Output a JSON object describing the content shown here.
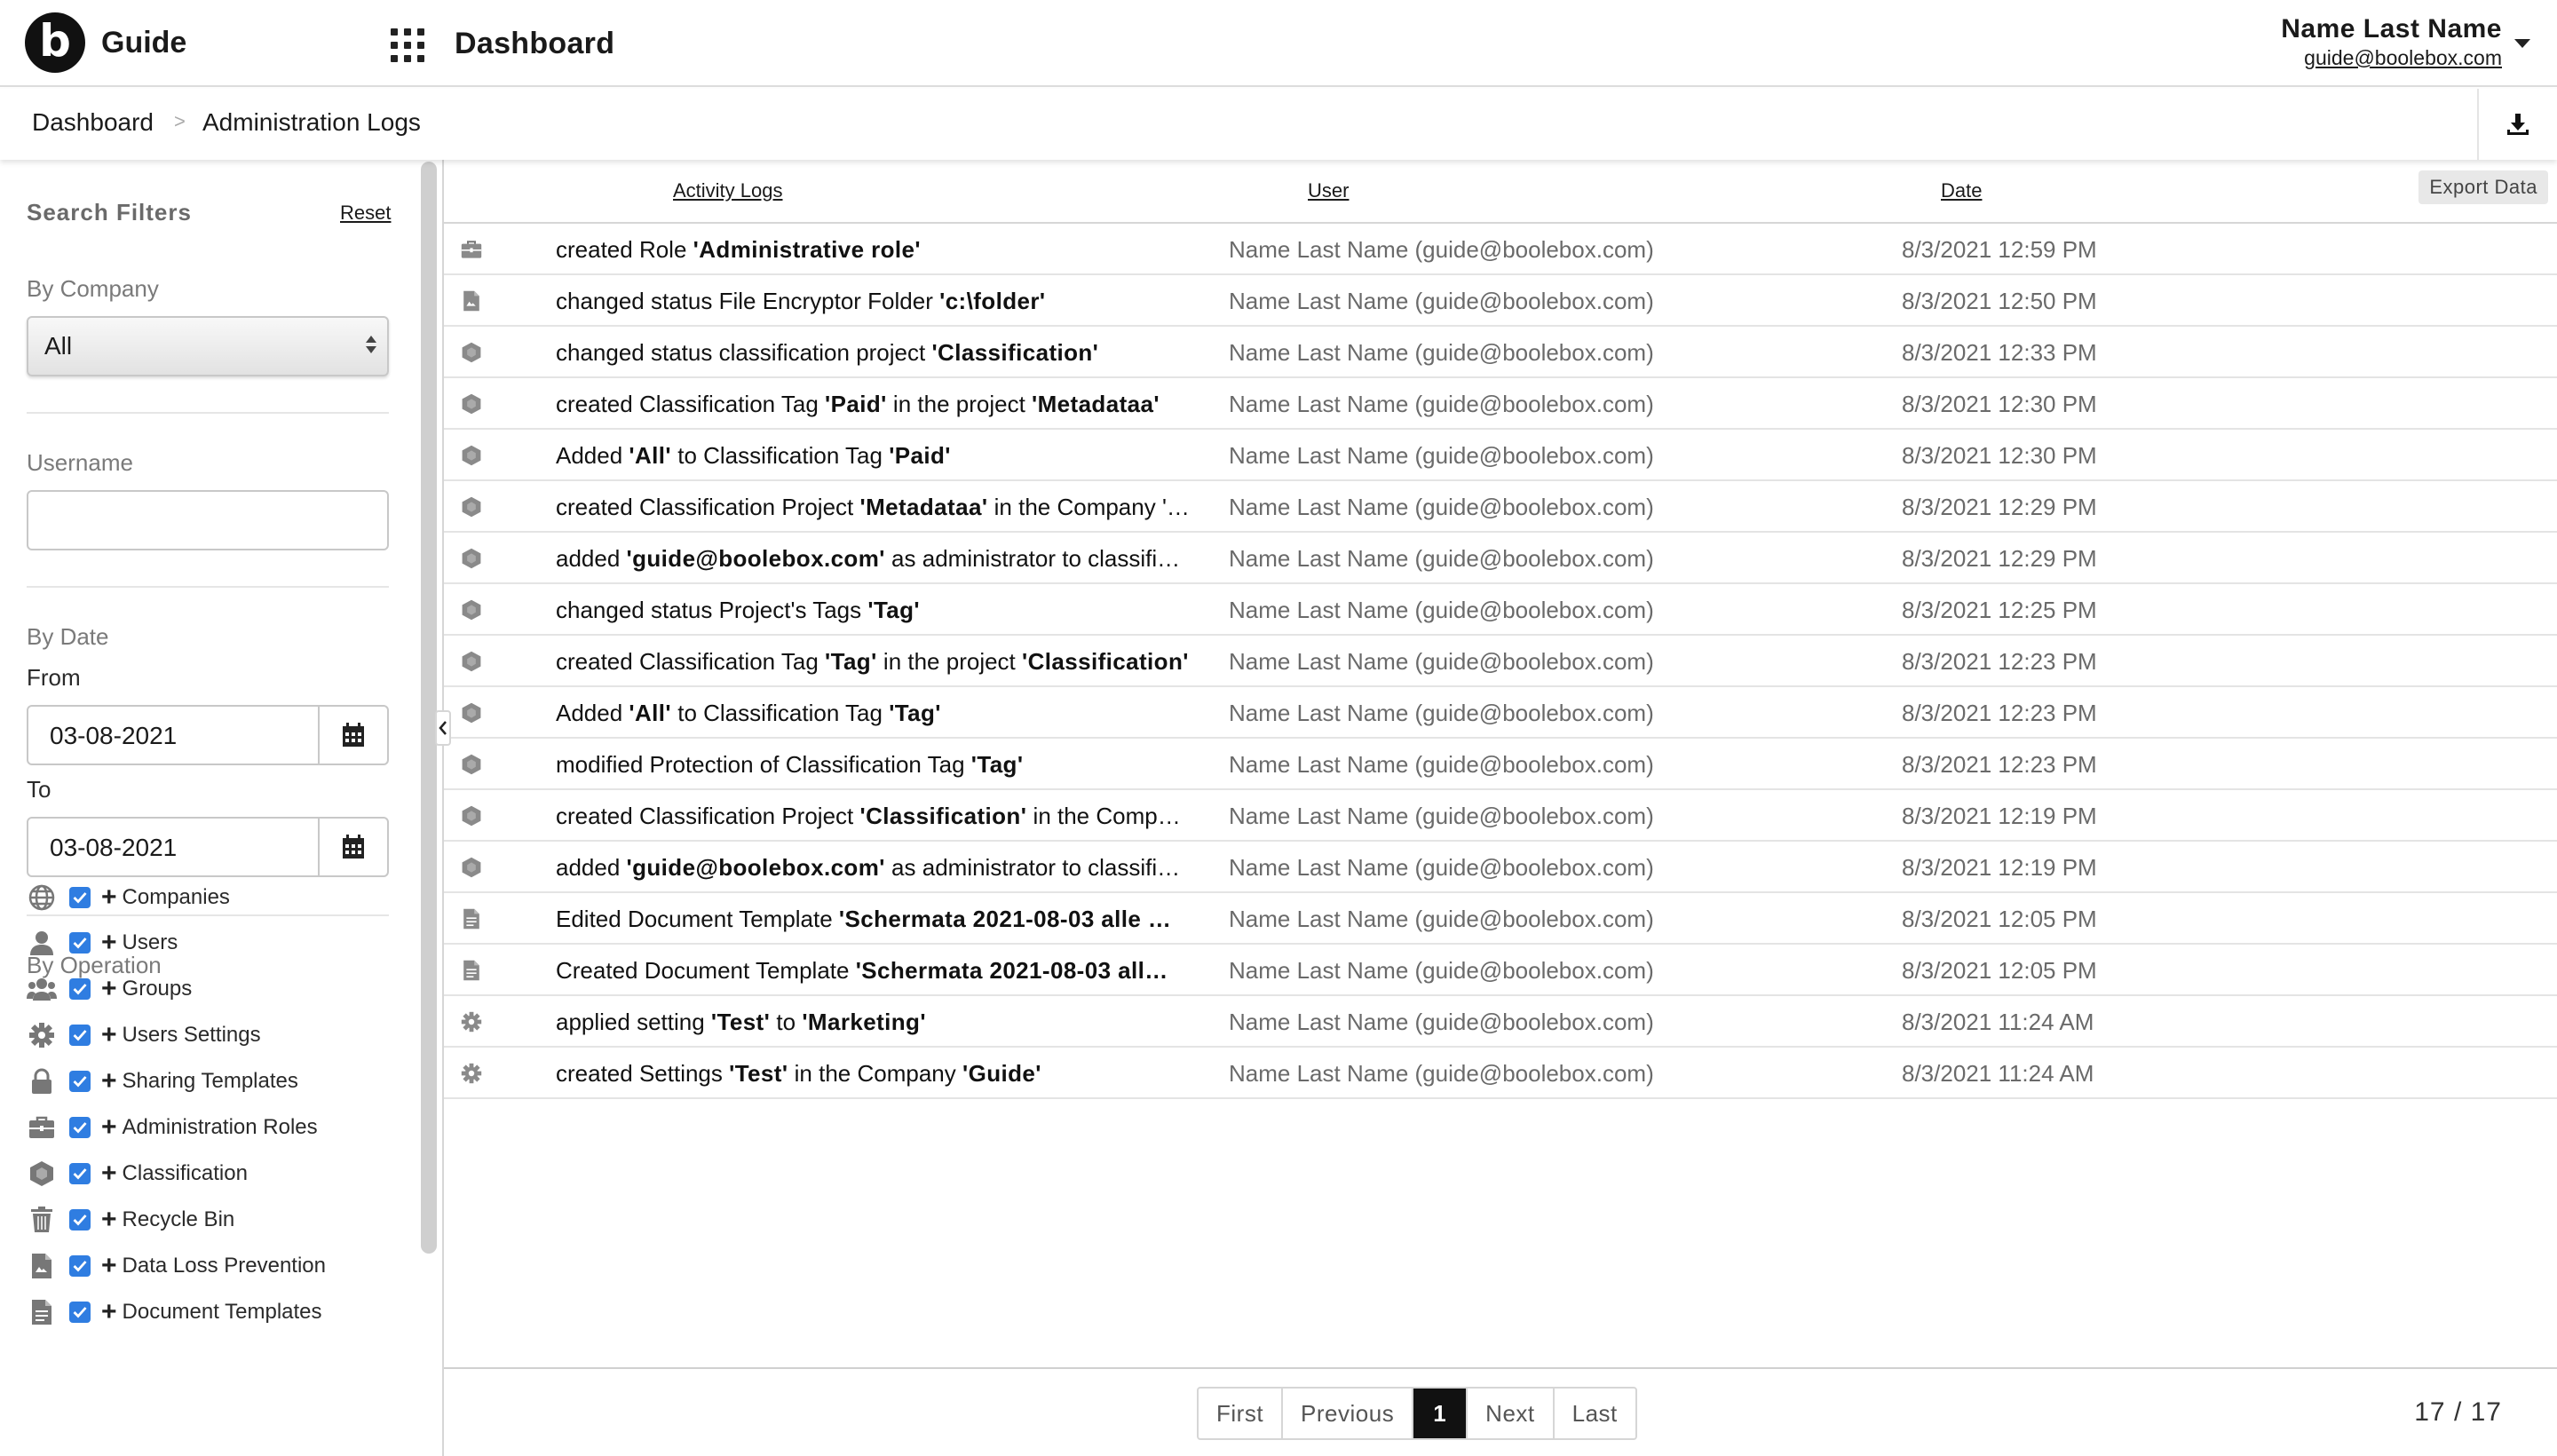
{
  "header": {
    "app_name": "Guide",
    "logo_letter": "b",
    "page_title": "Dashboard",
    "user_name": "Name Last Name",
    "user_email": "guide@boolebox.com"
  },
  "breadcrumb": {
    "items": [
      "Dashboard",
      "Administration Logs"
    ],
    "separator": ">"
  },
  "export": {
    "tooltip": "Export Data",
    "icon": "download-icon"
  },
  "filters": {
    "title": "Search Filters",
    "reset_label": "Reset",
    "company_label": "By Company",
    "company_value": "All",
    "username_label": "Username",
    "username_value": "",
    "date_label": "By Date",
    "from_label": "From",
    "from_value": "03-08-2021",
    "to_label": "To",
    "to_value": "03-08-2021",
    "operation_label": "By Operation",
    "operations": [
      {
        "label": "Companies",
        "icon": "globe-icon",
        "checked": true
      },
      {
        "label": "Users",
        "icon": "user-icon",
        "checked": true
      },
      {
        "label": "Groups",
        "icon": "users-group-icon",
        "checked": true
      },
      {
        "label": "Users Settings",
        "icon": "gear-icon",
        "checked": true
      },
      {
        "label": "Sharing Templates",
        "icon": "lock-icon",
        "checked": true
      },
      {
        "label": "Administration Roles",
        "icon": "briefcase-icon",
        "checked": true
      },
      {
        "label": "Classification",
        "icon": "hexagon-icon",
        "checked": true
      },
      {
        "label": "Recycle Bin",
        "icon": "trash-icon",
        "checked": true
      },
      {
        "label": "Data Loss Prevention",
        "icon": "dlp-file-icon",
        "checked": true
      },
      {
        "label": "Document Templates",
        "icon": "document-icon",
        "checked": true
      }
    ]
  },
  "table": {
    "columns": [
      "Activity Logs",
      "User",
      "Date"
    ],
    "rows": [
      {
        "icon": "briefcase-icon",
        "parts": [
          [
            "created Role ",
            false
          ],
          [
            "'Administrative role'",
            true
          ]
        ],
        "user": "Name Last Name (guide@boolebox.com)",
        "date": "8/3/2021 12:59 PM"
      },
      {
        "icon": "dlp-file-icon",
        "parts": [
          [
            "changed status File Encryptor Folder ",
            false
          ],
          [
            "'c:\\folder'",
            true
          ]
        ],
        "user": "Name Last Name (guide@boolebox.com)",
        "date": "8/3/2021 12:50 PM"
      },
      {
        "icon": "hexagon-icon",
        "parts": [
          [
            "changed status classification project ",
            false
          ],
          [
            "'Classification'",
            true
          ]
        ],
        "user": "Name Last Name (guide@boolebox.com)",
        "date": "8/3/2021 12:33 PM"
      },
      {
        "icon": "hexagon-icon",
        "parts": [
          [
            "created Classification Tag ",
            false
          ],
          [
            "'Paid'",
            true
          ],
          [
            " in the project ",
            false
          ],
          [
            "'Metadataa'",
            true
          ]
        ],
        "user": "Name Last Name (guide@boolebox.com)",
        "date": "8/3/2021 12:30 PM"
      },
      {
        "icon": "hexagon-icon",
        "parts": [
          [
            "Added ",
            false
          ],
          [
            "'All'",
            true
          ],
          [
            " to Classification Tag ",
            false
          ],
          [
            "'Paid'",
            true
          ]
        ],
        "user": "Name Last Name (guide@boolebox.com)",
        "date": "8/3/2021 12:30 PM"
      },
      {
        "icon": "hexagon-icon",
        "parts": [
          [
            "created Classification Project ",
            false
          ],
          [
            "'Metadataa'",
            true
          ],
          [
            " in the Company '",
            false
          ],
          [
            "…",
            false
          ]
        ],
        "user": "Name Last Name (guide@boolebox.com)",
        "date": "8/3/2021 12:29 PM"
      },
      {
        "icon": "hexagon-icon",
        "parts": [
          [
            "added ",
            false
          ],
          [
            "'guide@boolebox.com'",
            true
          ],
          [
            " as administrator to classifica…",
            false
          ]
        ],
        "user": "Name Last Name (guide@boolebox.com)",
        "date": "8/3/2021 12:29 PM"
      },
      {
        "icon": "hexagon-icon",
        "parts": [
          [
            "changed status Project's Tags ",
            false
          ],
          [
            "'Tag'",
            true
          ]
        ],
        "user": "Name Last Name (guide@boolebox.com)",
        "date": "8/3/2021 12:25 PM"
      },
      {
        "icon": "hexagon-icon",
        "parts": [
          [
            "created Classification Tag ",
            false
          ],
          [
            "'Tag'",
            true
          ],
          [
            " in the project ",
            false
          ],
          [
            "'Classification'",
            true
          ]
        ],
        "user": "Name Last Name (guide@boolebox.com)",
        "date": "8/3/2021 12:23 PM"
      },
      {
        "icon": "hexagon-icon",
        "parts": [
          [
            "Added ",
            false
          ],
          [
            "'All'",
            true
          ],
          [
            " to Classification Tag ",
            false
          ],
          [
            "'Tag'",
            true
          ]
        ],
        "user": "Name Last Name (guide@boolebox.com)",
        "date": "8/3/2021 12:23 PM"
      },
      {
        "icon": "hexagon-icon",
        "parts": [
          [
            "modified Protection of Classification Tag ",
            false
          ],
          [
            "'Tag'",
            true
          ]
        ],
        "user": "Name Last Name (guide@boolebox.com)",
        "date": "8/3/2021 12:23 PM"
      },
      {
        "icon": "hexagon-icon",
        "parts": [
          [
            "created Classification Project ",
            false
          ],
          [
            "'Classification'",
            true
          ],
          [
            " in the Compan…",
            false
          ]
        ],
        "user": "Name Last Name (guide@boolebox.com)",
        "date": "8/3/2021 12:19 PM"
      },
      {
        "icon": "hexagon-icon",
        "parts": [
          [
            "added ",
            false
          ],
          [
            "'guide@boolebox.com'",
            true
          ],
          [
            " as administrator to classifica…",
            false
          ]
        ],
        "user": "Name Last Name (guide@boolebox.com)",
        "date": "8/3/2021 12:19 PM"
      },
      {
        "icon": "document-icon",
        "parts": [
          [
            "Edited Document Template ",
            false
          ],
          [
            "'Schermata 2021-08-03 alle …",
            true
          ]
        ],
        "user": "Name Last Name (guide@boolebox.com)",
        "date": "8/3/2021 12:05 PM"
      },
      {
        "icon": "document-icon",
        "parts": [
          [
            "Created Document Template ",
            false
          ],
          [
            "'Schermata 2021-08-03 all…",
            true
          ]
        ],
        "user": "Name Last Name (guide@boolebox.com)",
        "date": "8/3/2021 12:05 PM"
      },
      {
        "icon": "gear-icon",
        "parts": [
          [
            "applied setting ",
            false
          ],
          [
            "'Test'",
            true
          ],
          [
            " to ",
            false
          ],
          [
            "'Marketing'",
            true
          ]
        ],
        "user": "Name Last Name (guide@boolebox.com)",
        "date": "8/3/2021 11:24 AM"
      },
      {
        "icon": "gear-icon",
        "parts": [
          [
            "created Settings ",
            false
          ],
          [
            "'Test'",
            true
          ],
          [
            " in the Company ",
            false
          ],
          [
            "'Guide'",
            true
          ]
        ],
        "user": "Name Last Name (guide@boolebox.com)",
        "date": "8/3/2021 11:24 AM"
      }
    ]
  },
  "pagination": {
    "first": "First",
    "previous": "Previous",
    "current": "1",
    "next": "Next",
    "last": "Last",
    "count": "17 / 17"
  },
  "colors": {
    "checkbox": "#2f7de1",
    "active_page": "#111111",
    "muted_text": "#6a6a6a"
  }
}
